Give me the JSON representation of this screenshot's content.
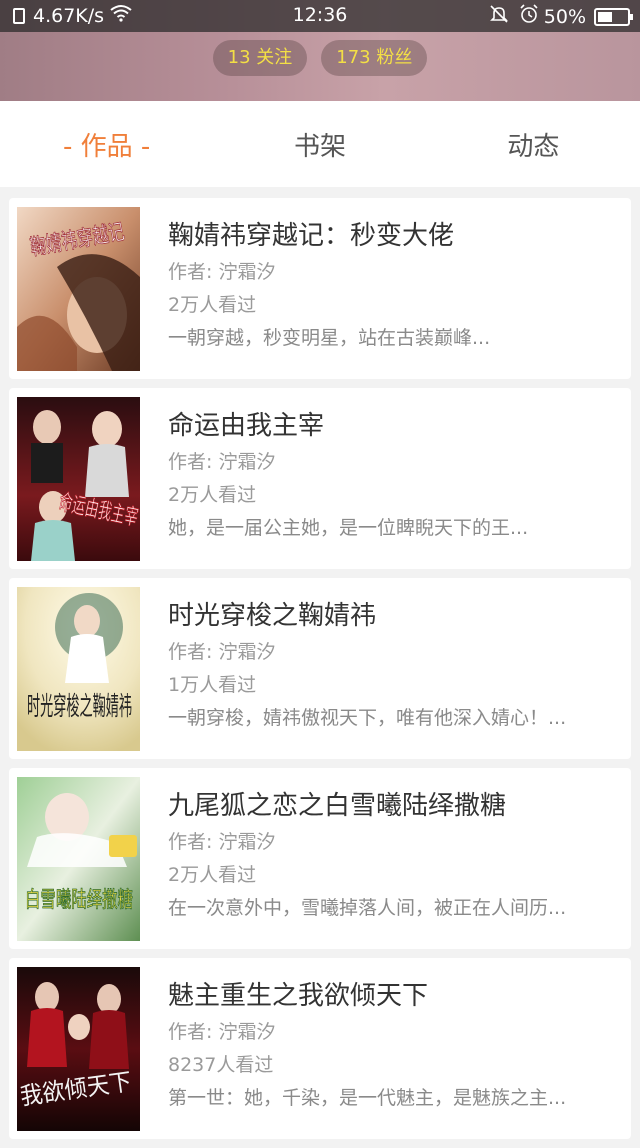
{
  "status_bar": {
    "speed": "4.67K/s",
    "time": "12:36",
    "battery": "50%"
  },
  "profile": {
    "follow_count": "13 关注",
    "fans_count": "173 粉丝"
  },
  "tabs": [
    {
      "label": "作品",
      "active": true
    },
    {
      "label": "书架",
      "active": false
    },
    {
      "label": "动态",
      "active": false
    }
  ],
  "books": [
    {
      "title": "鞠婧祎穿越记：秒变大佬",
      "author": "作者: 泞霜汐",
      "views": "2万人看过",
      "desc": "一朝穿越，秒变明星，站在古装巅峰...",
      "cover_text": "鞠婧祎穿越记"
    },
    {
      "title": "命运由我主宰",
      "author": "作者: 泞霜汐",
      "views": "2万人看过",
      "desc": "她，是一届公主她，是一位睥睨天下的王...",
      "cover_text": "命运由我主宰"
    },
    {
      "title": "时光穿梭之鞠婧祎",
      "author": "作者: 泞霜汐",
      "views": "1万人看过",
      "desc": "一朝穿梭，婧祎傲视天下，唯有他深入婧心！...",
      "cover_text": "时光穿梭之鞠婧祎"
    },
    {
      "title": "九尾狐之恋之白雪曦陆绎撒糖",
      "author": "作者: 泞霜汐",
      "views": "2万人看过",
      "desc": "在一次意外中，雪曦掉落人间，被正在人间历...",
      "cover_text": "白雪曦陆绎撒糖"
    },
    {
      "title": "魅主重生之我欲倾天下",
      "author": "作者: 泞霜汐",
      "views": "8237人看过",
      "desc": "第一世：她，千染，是一代魅主，是魅族之主...",
      "cover_text": "我欲倾天下"
    }
  ],
  "colors": {
    "accent": "#f07f3a",
    "pill_text": "#f3df45"
  }
}
